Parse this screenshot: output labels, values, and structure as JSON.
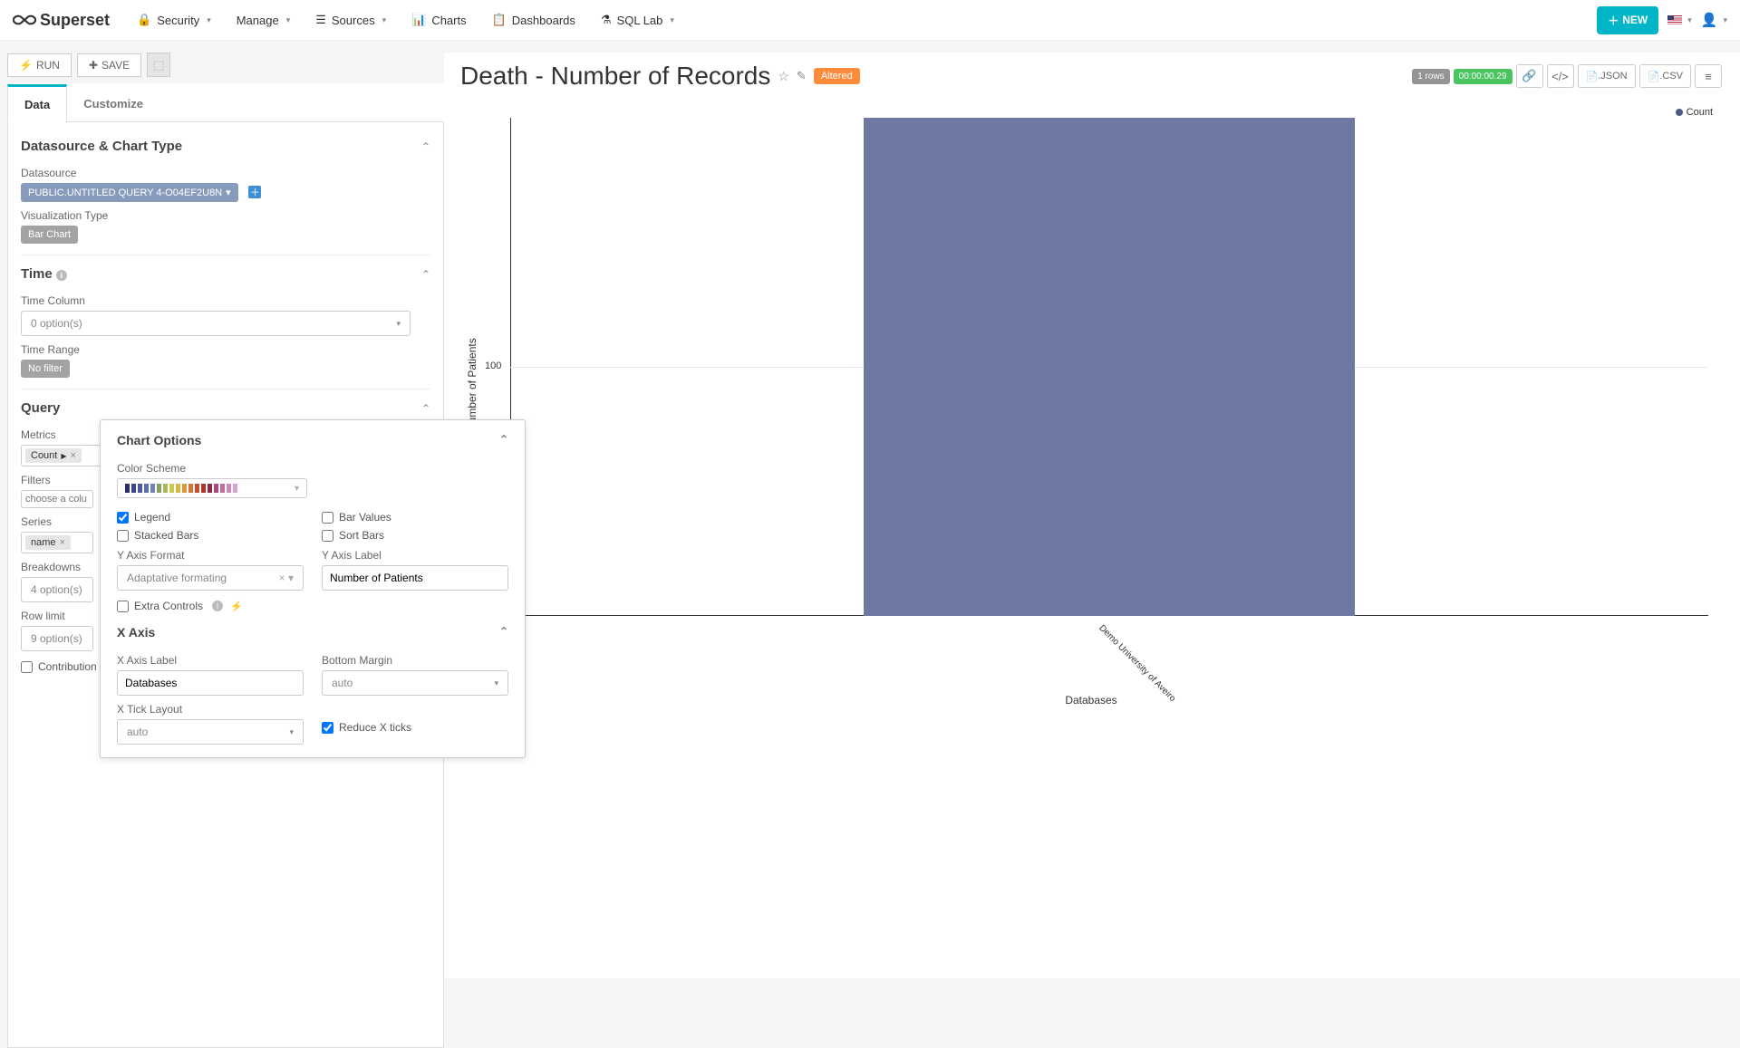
{
  "nav": {
    "brand": "Superset",
    "items": [
      {
        "icon": "lock",
        "label": "Security",
        "has_caret": true
      },
      {
        "icon": "",
        "label": "Manage",
        "has_caret": true
      },
      {
        "icon": "stack",
        "label": "Sources",
        "has_caret": true
      },
      {
        "icon": "bars",
        "label": "Charts",
        "has_caret": false
      },
      {
        "icon": "dash",
        "label": "Dashboards",
        "has_caret": false
      },
      {
        "icon": "flask",
        "label": "SQL Lab",
        "has_caret": true
      }
    ],
    "new_btn": "NEW"
  },
  "toolbar": {
    "run": "RUN",
    "save": "SAVE"
  },
  "tabs": {
    "data": "Data",
    "customize": "Customize"
  },
  "datasource_section": {
    "title": "Datasource & Chart Type",
    "ds_label": "Datasource",
    "ds_value": "PUBLIC.UNTITLED QUERY 4-O04EF2U8N",
    "viz_label": "Visualization Type",
    "viz_value": "Bar Chart"
  },
  "time_section": {
    "title": "Time",
    "col_label": "Time Column",
    "col_value": "0 option(s)",
    "range_label": "Time Range",
    "range_value": "No filter"
  },
  "query_section": {
    "title": "Query",
    "metrics_label": "Metrics",
    "metric_tag": "Count",
    "filters_label": "Filters",
    "filters_placeholder": "choose a colu",
    "series_label": "Series",
    "series_tag": "name",
    "breakdowns_label": "Breakdowns",
    "breakdowns_value": "4 option(s)",
    "rowlimit_label": "Row limit",
    "rowlimit_value": "9 option(s)",
    "contribution_label": "Contribution"
  },
  "chart_options": {
    "title": "Chart Options",
    "color_label": "Color Scheme",
    "legend": "Legend",
    "stacked": "Stacked Bars",
    "barvalues": "Bar Values",
    "sortbars": "Sort Bars",
    "yfmt_label": "Y Axis Format",
    "yfmt_value": "Adaptative formating",
    "ylabel_label": "Y Axis Label",
    "ylabel_value": "Number of Patients",
    "extra": "Extra Controls",
    "xaxis_title": "X Axis",
    "xlabel_label": "X Axis Label",
    "xlabel_value": "Databases",
    "bmargin_label": "Bottom Margin",
    "bmargin_value": "auto",
    "xtick_label": "X Tick Layout",
    "xtick_value": "auto",
    "reduce": "Reduce X ticks"
  },
  "chart_head": {
    "title": "Death - Number of Records",
    "altered": "Altered",
    "rows": "1 rows",
    "time": "00:00:00.29",
    "json": ".JSON",
    "csv": ".CSV"
  },
  "chart_data": {
    "type": "bar",
    "title": "Death - Number of Records",
    "xlabel": "Databases",
    "ylabel": "Number of Patients",
    "ylim": [
      0,
      200
    ],
    "yticks": [
      100
    ],
    "legend": [
      "Count"
    ],
    "categories": [
      "Demo University of Aveiro"
    ],
    "series": [
      {
        "name": "Count",
        "values": [
          200
        ],
        "color": "#6e78a2"
      }
    ]
  },
  "palette_colors": [
    "#2e2e6e",
    "#3c468c",
    "#4a5aa0",
    "#5a6eb1",
    "#6f84bc",
    "#8aa05a",
    "#a9b85e",
    "#c9c94e",
    "#d9b746",
    "#d99a3e",
    "#d57535",
    "#c74f2d",
    "#b2332b",
    "#8f2a46",
    "#a94a7a",
    "#c06ea0",
    "#c98bbd",
    "#d3a6d2"
  ]
}
